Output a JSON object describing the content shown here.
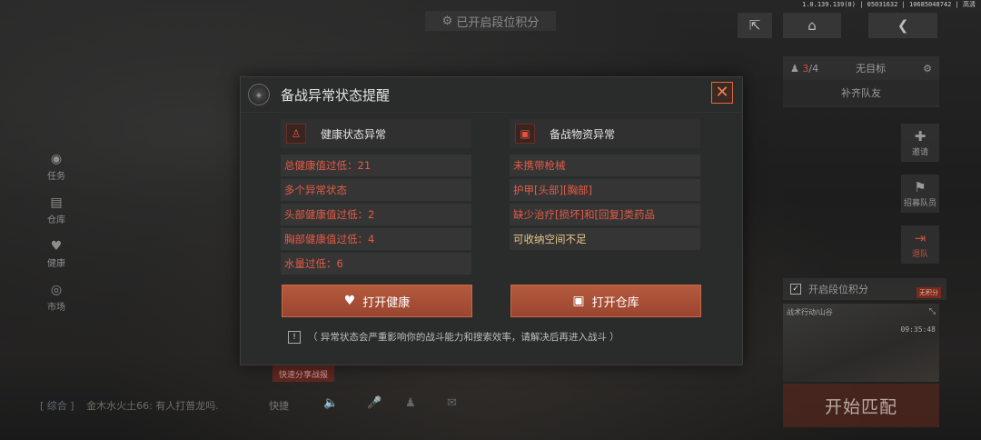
{
  "top": {
    "ranked_label": "已开启段位积分",
    "build_info": "1.0.139.139(8) | 05031632 | 10685048742 | 高清"
  },
  "leftnav": [
    {
      "label": "任务",
      "icon": "task-icon"
    },
    {
      "label": "仓库",
      "icon": "warehouse-icon"
    },
    {
      "label": "健康",
      "icon": "health-icon"
    },
    {
      "label": "市场",
      "icon": "market-icon"
    }
  ],
  "right": {
    "team_count_current": "3",
    "team_count_total": "/4",
    "team_goal": "无目标",
    "fill_team": "补齐队友",
    "invite": "邀请",
    "recruit": "招募队员",
    "leave": "退队",
    "ranked_toggle": "开启段位积分",
    "ranked_tag": "无积分",
    "map_name": "战术行动/山谷",
    "map_time": "09:35:48",
    "start": "开始匹配"
  },
  "chat": {
    "channel": "[ 综合 ]",
    "sender": "金木水火土66:",
    "message": "有人打普龙吗.",
    "quick": "快捷",
    "share": "快速分享战报"
  },
  "modal": {
    "title": "备战异常状态提醒",
    "health": {
      "title": "健康状态异常",
      "items": [
        "总健康值过低：21",
        "多个异常状态",
        "头部健康值过低：2",
        "胸部健康值过低：4",
        "水量过低：6"
      ],
      "button": "打开健康"
    },
    "supplies": {
      "title": "备战物资异常",
      "items": [
        "未携带枪械",
        "护甲[头部][胸部]",
        "缺少治疗[损坏]和[回复]类药品",
        "可收纳空间不足"
      ],
      "button": "打开仓库"
    },
    "note": "（ 异常状态会严重影响你的战斗能力和搜索效率，请解决后再进入战斗 ）"
  },
  "colors": {
    "accent": "#b55a3c",
    "error_text": "#e35b45",
    "warning_text": "#e7c98a",
    "close": "#f07e50"
  }
}
